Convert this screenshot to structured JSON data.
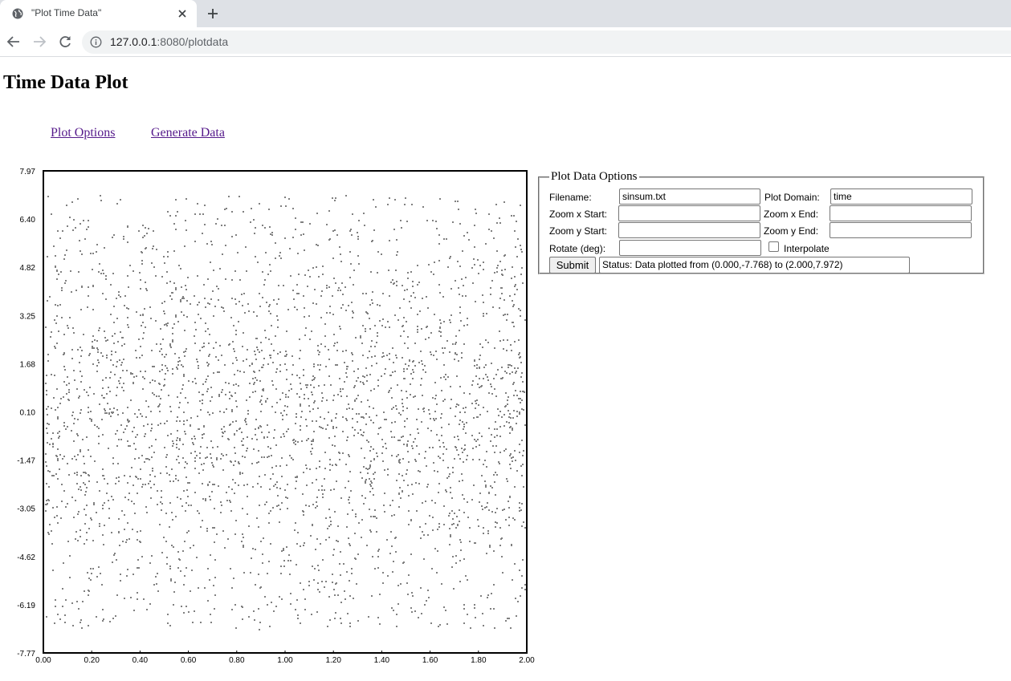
{
  "browser": {
    "tab_title": "\"Plot Time Data\"",
    "url_host": "127.0.0.1",
    "url_path": ":8080/plotdata"
  },
  "page": {
    "heading": "Time Data Plot",
    "links": [
      "Plot Options",
      "Generate Data"
    ]
  },
  "form": {
    "legend": "Plot Data Options",
    "filename_label": "Filename:",
    "filename_value": "sinsum.txt",
    "domain_label": "Plot Domain:",
    "domain_value": "time",
    "zoom_x_start_label": "Zoom x Start:",
    "zoom_x_start_value": "",
    "zoom_x_end_label": "Zoom x End:",
    "zoom_x_end_value": "",
    "zoom_y_start_label": "Zoom y Start:",
    "zoom_y_start_value": "",
    "zoom_y_end_label": "Zoom y End:",
    "zoom_y_end_value": "",
    "rotate_label": "Rotate (deg):",
    "rotate_value": "",
    "interpolate_label": "Interpolate",
    "interpolate_checked": false,
    "submit_label": "Submit",
    "status": "Status: Data plotted from (0.000,-7.768) to (2.000,7.972)"
  },
  "chart_data": {
    "type": "scatter",
    "title": "",
    "xlabel": "",
    "ylabel": "",
    "xlim": [
      0.0,
      2.0
    ],
    "ylim": [
      -7.77,
      7.97
    ],
    "x_ticks": [
      "0.00",
      "0.20",
      "0.40",
      "0.60",
      "0.80",
      "1.00",
      "1.20",
      "1.40",
      "1.60",
      "1.80",
      "2.00"
    ],
    "y_ticks": [
      "7.97",
      "6.40",
      "4.82",
      "3.25",
      "1.68",
      "0.10",
      "-1.47",
      "-3.05",
      "-4.62",
      "-6.19",
      "-7.77"
    ],
    "series": [
      {
        "color": "#808080",
        "x_range": [
          0.0,
          2.0
        ],
        "y_range": [
          -7.768,
          7.972
        ],
        "description_shown": "dense gray point cloud spanning the full plot area"
      }
    ],
    "grid": false
  },
  "colors": {
    "link": "#551a8b",
    "point": "#808080",
    "frame": "#000000"
  }
}
